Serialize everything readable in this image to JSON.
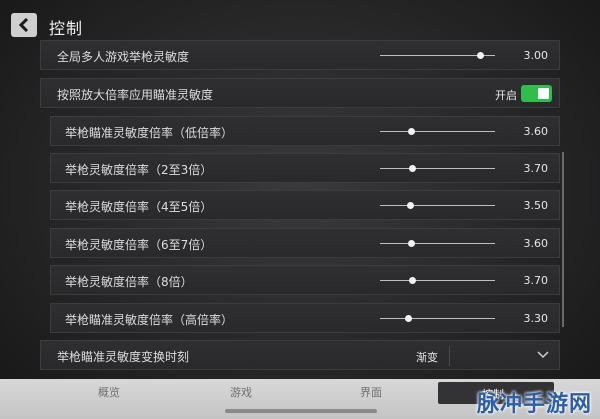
{
  "header": {
    "title": "控制",
    "back_icon": "chevron-left-icon"
  },
  "global_sensitivity": {
    "label": "全局多人游戏举枪灵敏度",
    "value": "3.00",
    "fraction": 0.87
  },
  "zoom_toggle": {
    "label": "按照放大倍率应用瞄准灵敏度",
    "state_text": "开启",
    "on": true,
    "color": "#2fbd4b"
  },
  "scope_rows": [
    {
      "label": "举枪瞄准灵敏度倍率（低倍率）",
      "value": "3.60",
      "fraction": 0.27
    },
    {
      "label": "举枪灵敏度倍率（2至3倍）",
      "value": "3.70",
      "fraction": 0.28
    },
    {
      "label": "举枪灵敏度倍率（4至5倍）",
      "value": "3.50",
      "fraction": 0.26
    },
    {
      "label": "举枪灵敏度倍率（6至7倍）",
      "value": "3.60",
      "fraction": 0.27
    },
    {
      "label": "举枪灵敏度倍率（8倍）",
      "value": "3.70",
      "fraction": 0.28
    },
    {
      "label": "举枪瞄准灵敏度倍率（高倍率）",
      "value": "3.30",
      "fraction": 0.24
    }
  ],
  "transition": {
    "label": "举枪瞄准灵敏度变换时刻",
    "value": "渐变"
  },
  "tabs": [
    {
      "label": "概览"
    },
    {
      "label": "游戏"
    },
    {
      "label": "界面"
    },
    {
      "label": "控制",
      "active": true
    }
  ],
  "watermark": "脉冲手游网"
}
